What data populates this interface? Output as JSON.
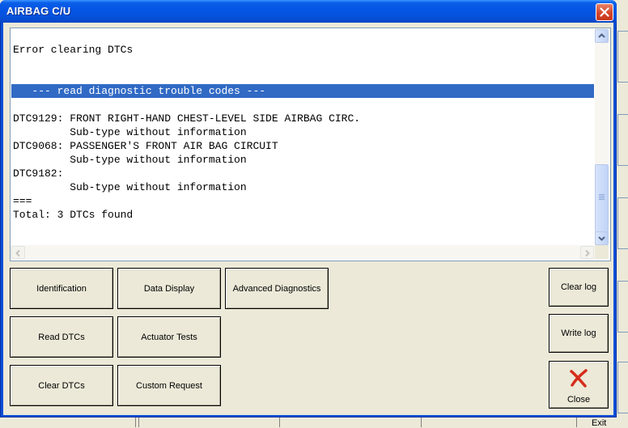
{
  "window": {
    "title": "AIRBAG C/U"
  },
  "log": {
    "lines": [
      "Error clearing DTCs",
      "   --- read diagnostic trouble codes ---",
      "DTC9129: FRONT RIGHT-HAND CHEST-LEVEL SIDE AIRBAG CIRC.",
      "         Sub-type without information",
      "DTC9068: PASSENGER'S FRONT AIR BAG CIRCUIT",
      "         Sub-type without information",
      "DTC9182:",
      "         Sub-type without information",
      "===",
      "Total: 3 DTCs found"
    ],
    "selected_line_index": 1
  },
  "buttons": {
    "identification": "Identification",
    "data_display": "Data Display",
    "advanced_diagnostics": "Advanced Diagnostics",
    "read_dtcs": "Read DTCs",
    "actuator_tests": "Actuator Tests",
    "clear_dtcs": "Clear DTCs",
    "custom_request": "Custom Request",
    "clear_log": "Clear log",
    "write_log": "Write log",
    "close": "Close"
  },
  "background": {
    "exit_label": "Exit"
  },
  "colors": {
    "titlebar": "#0554e3",
    "selection": "#316ac5",
    "close_icon": "#d62c1c"
  },
  "icons": {
    "window_close": "close-x-icon",
    "close_button": "red-x-icon"
  }
}
